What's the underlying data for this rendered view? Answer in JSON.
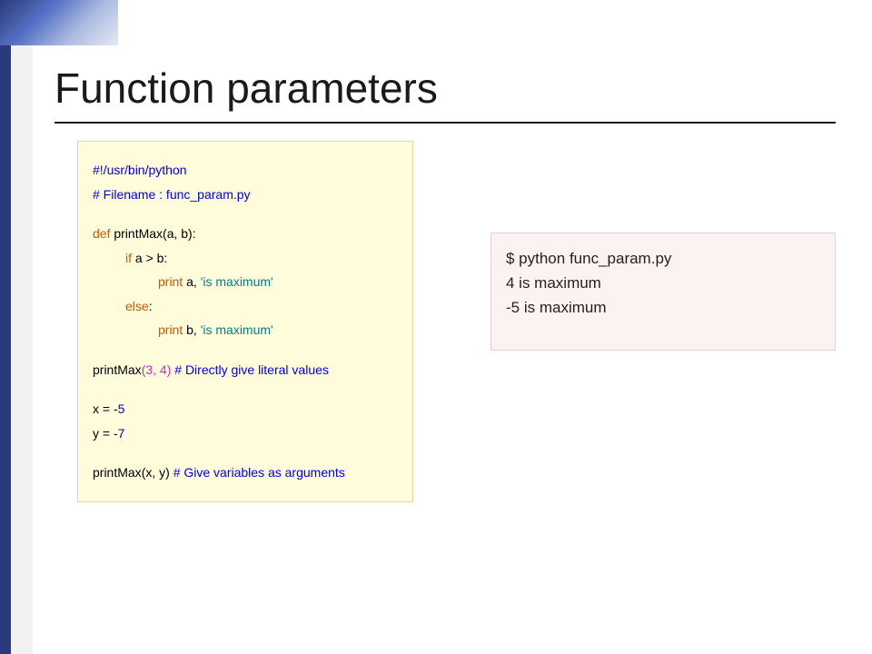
{
  "title": "Function parameters",
  "code": {
    "shebang": "#!/usr/bin/python",
    "filename_comment": "# Filename : func_param.py",
    "def_kw": "def",
    "func_name": " printMax",
    "def_params": "(a, b):",
    "if_kw": "if ",
    "if_cond": "a > b:",
    "print_kw_1": "print ",
    "print_arg_1": "a, ",
    "print_str_1": "'is maximum'",
    "else_kw": "else",
    "else_colon": ":",
    "print_kw_2": "print ",
    "print_arg_2": "b, ",
    "print_str_2": "'is maximum'",
    "call1_fn": "printMax",
    "call1_args": "(3, 4) ",
    "call1_comment": "# Directly give literal values",
    "assign_x_lhs": "x = -",
    "assign_x_val": "5",
    "assign_y_lhs": "y = -",
    "assign_y_val": "7",
    "call2_fn": "printMax",
    "call2_args": "(x, y) ",
    "call2_comment": "# Give variables as arguments"
  },
  "output": {
    "line1": "$ python func_param.py",
    "line2": "4 is maximum",
    "line3": "-5 is maximum"
  }
}
